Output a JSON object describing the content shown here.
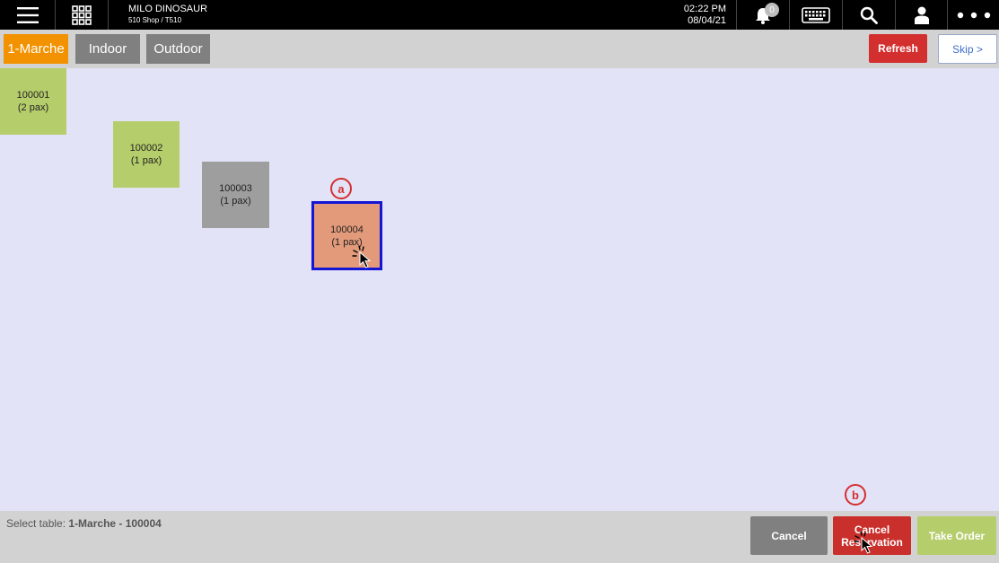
{
  "header": {
    "shop_name": "MILO DINOSAUR",
    "shop_sub": "510 Shop / T510",
    "time": "02:22 PM",
    "date": "08/04/21",
    "notification_count": "0"
  },
  "zones": [
    {
      "label": "1-Marche",
      "color": "#f39200",
      "selected": true
    },
    {
      "label": "Indoor",
      "color": "#808080",
      "selected": false
    },
    {
      "label": "Outdoor",
      "color": "#808080",
      "selected": false
    }
  ],
  "toolbar": {
    "refresh_label": "Refresh",
    "skip_label": "Skip >"
  },
  "tables": [
    {
      "id": "100001",
      "pax": "(2 pax)",
      "status_color": "#b5cd6a"
    },
    {
      "id": "100002",
      "pax": "(1 pax)",
      "status_color": "#b5cd6a"
    },
    {
      "id": "100003",
      "pax": "(1 pax)",
      "status_color": "#9e9e9e"
    },
    {
      "id": "100004",
      "pax": "(1 pax)",
      "status_color": "#e29a7a",
      "selected_border": "#1515d4"
    }
  ],
  "annotations": {
    "a": "a",
    "b": "b"
  },
  "footer": {
    "select_label": "Select table:",
    "select_value": "1-Marche - 100004",
    "cancel_label": "Cancel",
    "cancel_reservation_line1": "Cancel",
    "cancel_reservation_line2": "Reservation",
    "take_order_label": "Take Order"
  },
  "colors": {
    "topbar": "#000000",
    "floor": "#e3e3f8",
    "bar": "#d2d2d2",
    "danger": "#d32f2f",
    "take_order": "#b5cd6a",
    "cancel": "#808080"
  }
}
